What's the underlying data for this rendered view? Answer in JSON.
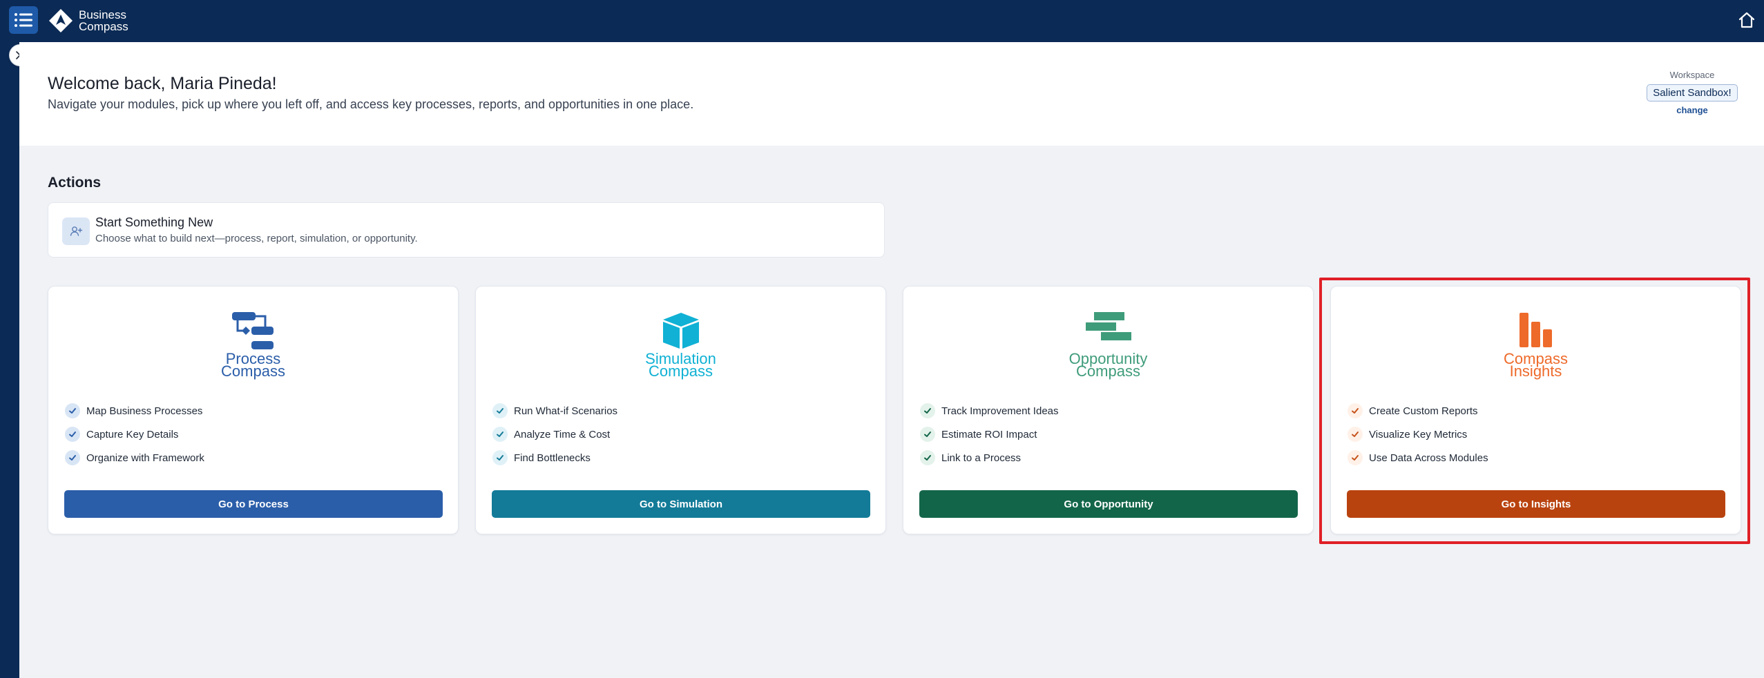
{
  "header": {
    "brand_line1": "Business",
    "brand_line2": "Compass",
    "menu_icon": "list-icon",
    "home_icon": "home-icon"
  },
  "rail": {
    "toggle_icon": "chevrons-right-icon"
  },
  "welcome": {
    "title": "Welcome back, Maria Pineda!",
    "subtitle": "Navigate your modules, pick up where you left off, and access key processes, reports, and opportunities in one place."
  },
  "workspace": {
    "label": "Workspace",
    "name": "Salient Sandbox!",
    "change": "change"
  },
  "actions": {
    "title": "Actions",
    "start": {
      "title": "Start Something New",
      "subtitle": "Choose what to build next—process, report, simulation, or opportunity.",
      "icon": "user-plus-icon"
    }
  },
  "modules": [
    {
      "name_line1": "Process",
      "name_line2": "Compass",
      "color": "#2b5ea9",
      "features": [
        "Map Business Processes",
        "Capture Key Details",
        "Organize with Framework"
      ],
      "button": "Go to Process"
    },
    {
      "name_line1": "Simulation",
      "name_line2": "Compass",
      "color": "#10b1d4",
      "button_color": "#137b98",
      "features": [
        "Run What-if Scenarios",
        "Analyze Time & Cost",
        "Find Bottlenecks"
      ],
      "button": "Go to Simulation"
    },
    {
      "name_line1": "Opportunity",
      "name_line2": "Compass",
      "color": "#3f9c7a",
      "button_color": "#13654a",
      "features": [
        "Track Improvement Ideas",
        "Estimate ROI Impact",
        "Link to a Process"
      ],
      "button": "Go to Opportunity"
    },
    {
      "name_line1": "Compass",
      "name_line2": "Insights",
      "color": "#ee6a2a",
      "button_color": "#b9430f",
      "features": [
        "Create Custom Reports",
        "Visualize Key Metrics",
        "Use Data Across Modules"
      ],
      "button": "Go to Insights"
    }
  ]
}
